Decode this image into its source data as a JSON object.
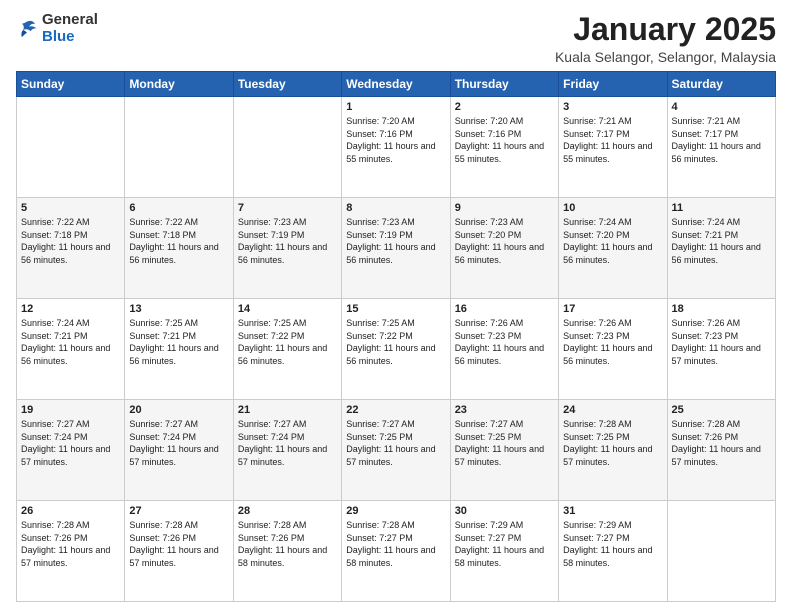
{
  "header": {
    "logo_general": "General",
    "logo_blue": "Blue",
    "month_title": "January 2025",
    "location": "Kuala Selangor, Selangor, Malaysia"
  },
  "days_of_week": [
    "Sunday",
    "Monday",
    "Tuesday",
    "Wednesday",
    "Thursday",
    "Friday",
    "Saturday"
  ],
  "weeks": [
    [
      {
        "day": "",
        "sunrise": "",
        "sunset": "",
        "daylight": ""
      },
      {
        "day": "",
        "sunrise": "",
        "sunset": "",
        "daylight": ""
      },
      {
        "day": "",
        "sunrise": "",
        "sunset": "",
        "daylight": ""
      },
      {
        "day": "1",
        "sunrise": "Sunrise: 7:20 AM",
        "sunset": "Sunset: 7:16 PM",
        "daylight": "Daylight: 11 hours and 55 minutes."
      },
      {
        "day": "2",
        "sunrise": "Sunrise: 7:20 AM",
        "sunset": "Sunset: 7:16 PM",
        "daylight": "Daylight: 11 hours and 55 minutes."
      },
      {
        "day": "3",
        "sunrise": "Sunrise: 7:21 AM",
        "sunset": "Sunset: 7:17 PM",
        "daylight": "Daylight: 11 hours and 55 minutes."
      },
      {
        "day": "4",
        "sunrise": "Sunrise: 7:21 AM",
        "sunset": "Sunset: 7:17 PM",
        "daylight": "Daylight: 11 hours and 56 minutes."
      }
    ],
    [
      {
        "day": "5",
        "sunrise": "Sunrise: 7:22 AM",
        "sunset": "Sunset: 7:18 PM",
        "daylight": "Daylight: 11 hours and 56 minutes."
      },
      {
        "day": "6",
        "sunrise": "Sunrise: 7:22 AM",
        "sunset": "Sunset: 7:18 PM",
        "daylight": "Daylight: 11 hours and 56 minutes."
      },
      {
        "day": "7",
        "sunrise": "Sunrise: 7:23 AM",
        "sunset": "Sunset: 7:19 PM",
        "daylight": "Daylight: 11 hours and 56 minutes."
      },
      {
        "day": "8",
        "sunrise": "Sunrise: 7:23 AM",
        "sunset": "Sunset: 7:19 PM",
        "daylight": "Daylight: 11 hours and 56 minutes."
      },
      {
        "day": "9",
        "sunrise": "Sunrise: 7:23 AM",
        "sunset": "Sunset: 7:20 PM",
        "daylight": "Daylight: 11 hours and 56 minutes."
      },
      {
        "day": "10",
        "sunrise": "Sunrise: 7:24 AM",
        "sunset": "Sunset: 7:20 PM",
        "daylight": "Daylight: 11 hours and 56 minutes."
      },
      {
        "day": "11",
        "sunrise": "Sunrise: 7:24 AM",
        "sunset": "Sunset: 7:21 PM",
        "daylight": "Daylight: 11 hours and 56 minutes."
      }
    ],
    [
      {
        "day": "12",
        "sunrise": "Sunrise: 7:24 AM",
        "sunset": "Sunset: 7:21 PM",
        "daylight": "Daylight: 11 hours and 56 minutes."
      },
      {
        "day": "13",
        "sunrise": "Sunrise: 7:25 AM",
        "sunset": "Sunset: 7:21 PM",
        "daylight": "Daylight: 11 hours and 56 minutes."
      },
      {
        "day": "14",
        "sunrise": "Sunrise: 7:25 AM",
        "sunset": "Sunset: 7:22 PM",
        "daylight": "Daylight: 11 hours and 56 minutes."
      },
      {
        "day": "15",
        "sunrise": "Sunrise: 7:25 AM",
        "sunset": "Sunset: 7:22 PM",
        "daylight": "Daylight: 11 hours and 56 minutes."
      },
      {
        "day": "16",
        "sunrise": "Sunrise: 7:26 AM",
        "sunset": "Sunset: 7:23 PM",
        "daylight": "Daylight: 11 hours and 56 minutes."
      },
      {
        "day": "17",
        "sunrise": "Sunrise: 7:26 AM",
        "sunset": "Sunset: 7:23 PM",
        "daylight": "Daylight: 11 hours and 56 minutes."
      },
      {
        "day": "18",
        "sunrise": "Sunrise: 7:26 AM",
        "sunset": "Sunset: 7:23 PM",
        "daylight": "Daylight: 11 hours and 57 minutes."
      }
    ],
    [
      {
        "day": "19",
        "sunrise": "Sunrise: 7:27 AM",
        "sunset": "Sunset: 7:24 PM",
        "daylight": "Daylight: 11 hours and 57 minutes."
      },
      {
        "day": "20",
        "sunrise": "Sunrise: 7:27 AM",
        "sunset": "Sunset: 7:24 PM",
        "daylight": "Daylight: 11 hours and 57 minutes."
      },
      {
        "day": "21",
        "sunrise": "Sunrise: 7:27 AM",
        "sunset": "Sunset: 7:24 PM",
        "daylight": "Daylight: 11 hours and 57 minutes."
      },
      {
        "day": "22",
        "sunrise": "Sunrise: 7:27 AM",
        "sunset": "Sunset: 7:25 PM",
        "daylight": "Daylight: 11 hours and 57 minutes."
      },
      {
        "day": "23",
        "sunrise": "Sunrise: 7:27 AM",
        "sunset": "Sunset: 7:25 PM",
        "daylight": "Daylight: 11 hours and 57 minutes."
      },
      {
        "day": "24",
        "sunrise": "Sunrise: 7:28 AM",
        "sunset": "Sunset: 7:25 PM",
        "daylight": "Daylight: 11 hours and 57 minutes."
      },
      {
        "day": "25",
        "sunrise": "Sunrise: 7:28 AM",
        "sunset": "Sunset: 7:26 PM",
        "daylight": "Daylight: 11 hours and 57 minutes."
      }
    ],
    [
      {
        "day": "26",
        "sunrise": "Sunrise: 7:28 AM",
        "sunset": "Sunset: 7:26 PM",
        "daylight": "Daylight: 11 hours and 57 minutes."
      },
      {
        "day": "27",
        "sunrise": "Sunrise: 7:28 AM",
        "sunset": "Sunset: 7:26 PM",
        "daylight": "Daylight: 11 hours and 57 minutes."
      },
      {
        "day": "28",
        "sunrise": "Sunrise: 7:28 AM",
        "sunset": "Sunset: 7:26 PM",
        "daylight": "Daylight: 11 hours and 58 minutes."
      },
      {
        "day": "29",
        "sunrise": "Sunrise: 7:28 AM",
        "sunset": "Sunset: 7:27 PM",
        "daylight": "Daylight: 11 hours and 58 minutes."
      },
      {
        "day": "30",
        "sunrise": "Sunrise: 7:29 AM",
        "sunset": "Sunset: 7:27 PM",
        "daylight": "Daylight: 11 hours and 58 minutes."
      },
      {
        "day": "31",
        "sunrise": "Sunrise: 7:29 AM",
        "sunset": "Sunset: 7:27 PM",
        "daylight": "Daylight: 11 hours and 58 minutes."
      },
      {
        "day": "",
        "sunrise": "",
        "sunset": "",
        "daylight": ""
      }
    ]
  ]
}
